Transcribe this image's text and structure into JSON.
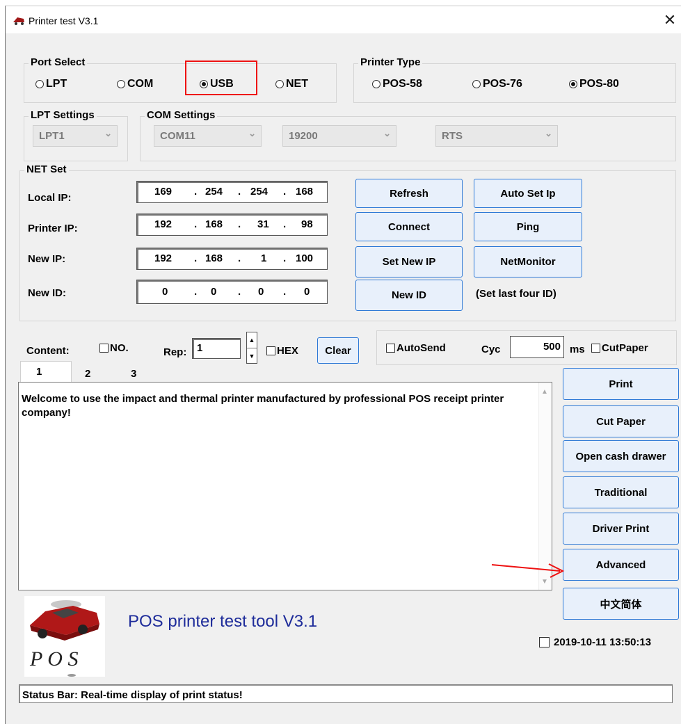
{
  "window": {
    "title": "Printer test V3.1",
    "close_glyph": "✕",
    "icon": "printer-app-icon"
  },
  "port_select": {
    "label": "Port Select",
    "options": [
      {
        "label": "LPT",
        "selected": false
      },
      {
        "label": "COM",
        "selected": false
      },
      {
        "label": "USB",
        "selected": true
      },
      {
        "label": "NET",
        "selected": false
      }
    ]
  },
  "printer_type": {
    "label": "Printer Type",
    "options": [
      {
        "label": "POS-58",
        "selected": false
      },
      {
        "label": "POS-76",
        "selected": false
      },
      {
        "label": "POS-80",
        "selected": true
      }
    ]
  },
  "lpt_settings": {
    "label": "LPT Settings",
    "port": "LPT1"
  },
  "com_settings": {
    "label": "COM Settings",
    "port": "COM11",
    "baud": "19200",
    "flow": "RTS"
  },
  "net_set": {
    "label": "NET Set",
    "local_ip": {
      "label": "Local IP:",
      "octets": [
        "169",
        "254",
        "254",
        "168"
      ]
    },
    "printer_ip": {
      "label": "Printer IP:",
      "octets": [
        "192",
        "168",
        "31",
        "98"
      ]
    },
    "new_ip": {
      "label": "New IP:",
      "octets": [
        "192",
        "168",
        "1",
        "100"
      ]
    },
    "new_id": {
      "label": "New ID:",
      "octets": [
        "0",
        "0",
        "0",
        "0"
      ]
    },
    "buttons": {
      "refresh": "Refresh",
      "auto_set_ip": "Auto Set Ip",
      "connect": "Connect",
      "ping": "Ping",
      "set_new_ip": "Set New IP",
      "net_monitor": "NetMonitor",
      "new_id": "New ID"
    },
    "hint": "(Set last four ID)"
  },
  "content": {
    "label": "Content:",
    "no_label": "NO.",
    "rep_label": "Rep:",
    "rep_value": "1",
    "hex_label": "HEX",
    "clear_label": "Clear",
    "autosend_label": "AutoSend",
    "cyc_label": "Cyc",
    "cyc_value": "500",
    "ms_label": "ms",
    "cutpaper_label": "CutPaper"
  },
  "tabs": [
    "1",
    "2",
    "3"
  ],
  "text": "Welcome to use the impact and thermal printer manufactured by professional POS receipt printer company!",
  "actions": {
    "print": "Print",
    "cut_paper": "Cut Paper",
    "open_cash_drawer": "Open cash drawer",
    "traditional": "Traditional",
    "driver_print": "Driver Print",
    "advanced": "Advanced",
    "chinese": "中文简体"
  },
  "brand": "POS printer test tool V3.1",
  "logo_text": "P O S",
  "datetime": "2019-10-11 13:50:13",
  "status_bar": "Status Bar: Real-time display of print status!",
  "colors": {
    "highlight": "#ee1111",
    "brand": "#1e2c9a",
    "button_border": "#2e79d6"
  }
}
